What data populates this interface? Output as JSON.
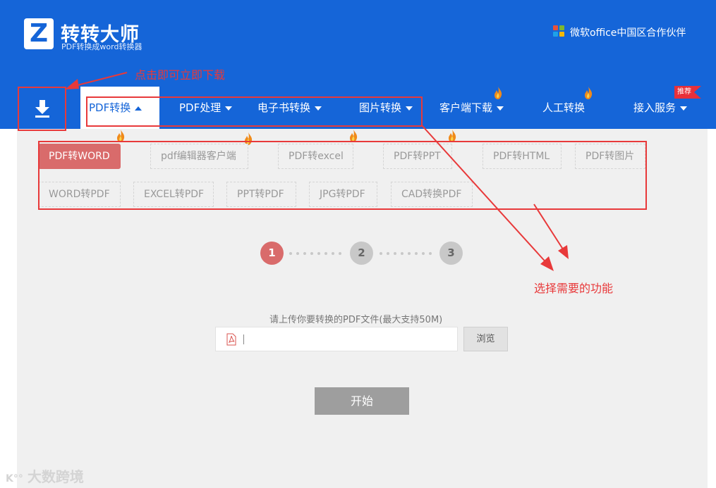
{
  "header": {
    "brand_name": "转转大师",
    "brand_sub": "PDF转换成word转换器",
    "logo_letter": "Z",
    "partner_text": "微软office中国区合作伙伴",
    "bg_color": "#1565d8"
  },
  "nav": {
    "download_icon": "download-arrow-icon",
    "items": [
      {
        "label": "PDF转换",
        "caret": "up",
        "active": true
      },
      {
        "label": "PDF处理",
        "caret": "down"
      },
      {
        "label": "电子书转换",
        "caret": "down"
      },
      {
        "label": "图片转换",
        "caret": "down"
      },
      {
        "label": "客户端下载",
        "caret": "down",
        "hot": true
      },
      {
        "label": "人工转换",
        "hot": true
      },
      {
        "label": "接入服务",
        "caret": "down"
      }
    ],
    "badge": "推荐"
  },
  "tools": {
    "row1": [
      "PDF转WORD",
      "pdf编辑器客户端",
      "PDF转excel",
      "PDF转PPT",
      "PDF转HTML",
      "PDF转图片"
    ],
    "row2": [
      "WORD转PDF",
      "EXCEL转PDF",
      "PPT转PDF",
      "JPG转PDF",
      "CAD转换PDF"
    ],
    "active_color": "#d96b6b"
  },
  "steps": [
    "1",
    "2",
    "3"
  ],
  "upload": {
    "label": "请上传你要转换的PDF文件(最大支持50M)",
    "browse": "浏览",
    "start": "开始"
  },
  "annotations": {
    "download_note": "点击即可立即下载",
    "select_note": "选择需要的功能",
    "color": "#e8393a"
  },
  "watermark": "大数跨境"
}
